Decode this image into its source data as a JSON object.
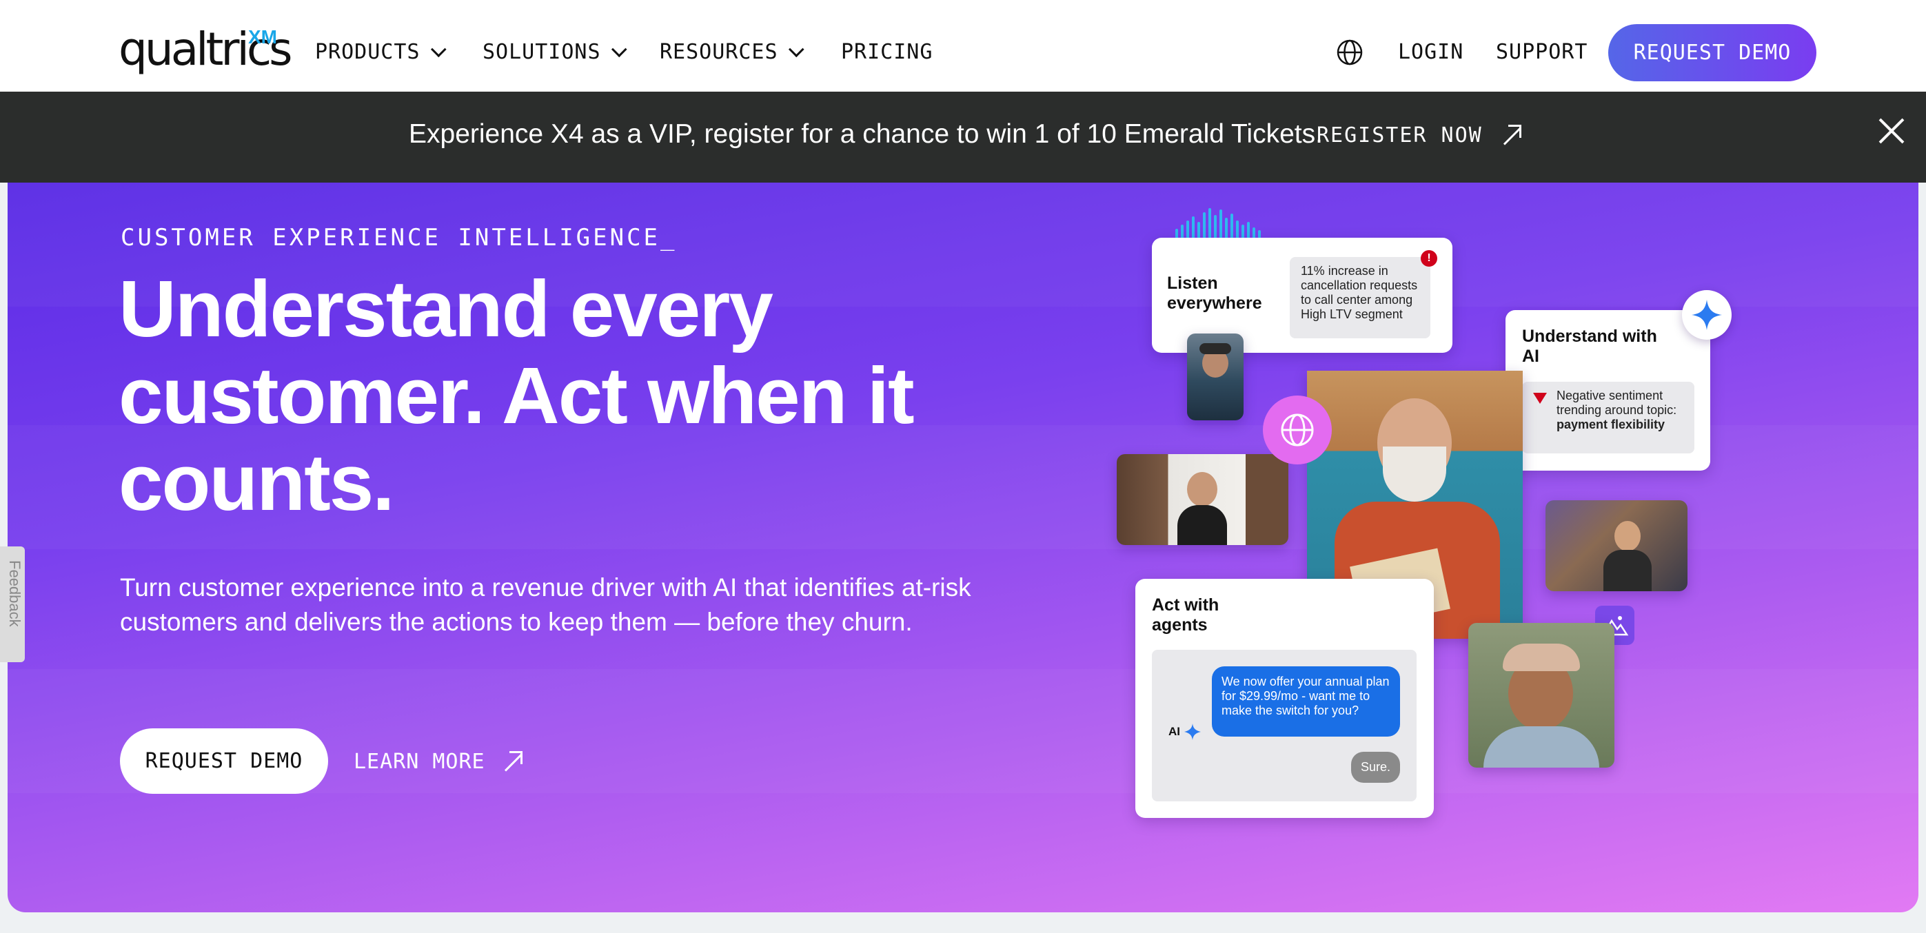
{
  "nav": {
    "logo": "qualtrics",
    "logo_mark": "XM",
    "items": [
      {
        "label": "PRODUCTS",
        "has_dropdown": true
      },
      {
        "label": "SOLUTIONS",
        "has_dropdown": true
      },
      {
        "label": "RESOURCES",
        "has_dropdown": true
      },
      {
        "label": "PRICING",
        "has_dropdown": false
      }
    ],
    "language_icon": "globe-icon",
    "login": "LOGIN",
    "support": "SUPPORT",
    "cta": "REQUEST DEMO"
  },
  "banner": {
    "text": "Experience X4 as a VIP, register for a chance to win 1 of 10 Emerald Tickets.",
    "link": "REGISTER NOW",
    "close_icon": "close-icon"
  },
  "hero": {
    "eyebrow": "CUSTOMER EXPERIENCE INTELLIGENCE_",
    "headline": "Understand every customer. Act when it counts.",
    "subheading": "Turn customer experience into a revenue driver with AI that identifies at-risk customers and delivers the actions to keep them — before they churn.",
    "primary_cta": "REQUEST DEMO",
    "secondary_cta": "LEARN MORE",
    "colors": {
      "gradient_start": "#5a2be6",
      "gradient_end": "#e27af3"
    }
  },
  "feedback_tab": "Feedback",
  "cards": {
    "listen": {
      "title": "Listen everywhere",
      "note": "11% increase in cancellation requests to call center among High LTV segment"
    },
    "understand": {
      "title": "Understand with AI",
      "note": "Negative sentiment trending around topic:",
      "note_bold": "payment flexibility"
    },
    "act": {
      "title": "Act with agents",
      "agent_message": "We now offer your annual plan for $29.99/mo - want me to make the switch for you?",
      "customer_reply": "Sure.",
      "ai_label": "AI"
    }
  }
}
